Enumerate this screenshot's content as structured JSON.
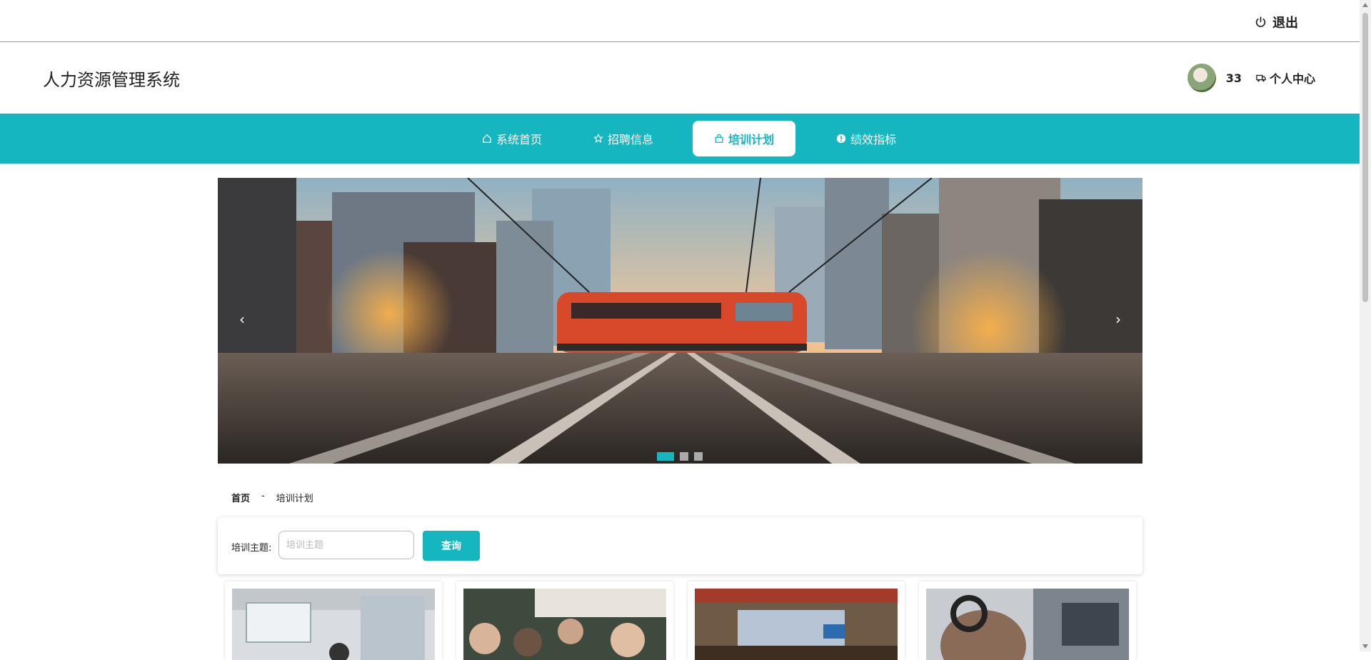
{
  "topbar": {
    "logout_label": "退出",
    "logout_icon": "power-icon"
  },
  "header": {
    "title": "人力资源管理系统",
    "username": "33",
    "center_label": "个人中心",
    "center_icon": "truck-icon"
  },
  "nav": {
    "items": [
      {
        "label": "系统首页",
        "icon": "home-icon",
        "active": false
      },
      {
        "label": "招聘信息",
        "icon": "star-icon",
        "active": false
      },
      {
        "label": "培训计划",
        "icon": "bag-icon",
        "active": true
      },
      {
        "label": "绩效指标",
        "icon": "info-circle-icon",
        "active": false
      }
    ],
    "accent_color": "#15b6c0"
  },
  "banner": {
    "prev_label": "‹",
    "next_label": "›",
    "slide_count": 3,
    "active_slide": 1
  },
  "breadcrumb": {
    "home": "首页",
    "separator": "-",
    "current": "培训计划"
  },
  "search": {
    "label": "培训主题:",
    "placeholder": "培训主题",
    "value": "",
    "button_label": "查询"
  },
  "cards": [
    {
      "image": "office-training-room"
    },
    {
      "image": "classroom-students"
    },
    {
      "image": "auditorium-lecture"
    },
    {
      "image": "headset-call-center"
    }
  ]
}
